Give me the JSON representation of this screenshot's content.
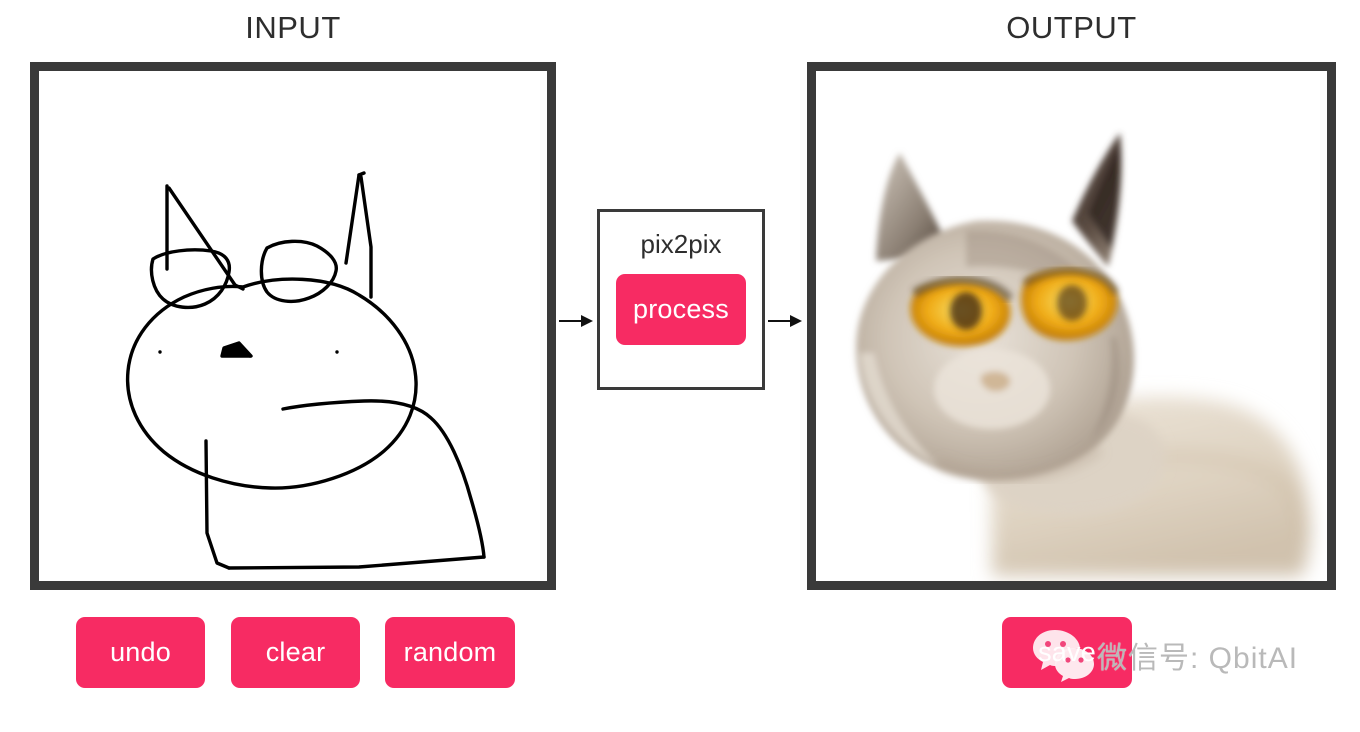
{
  "panels": {
    "input_title": "INPUT",
    "output_title": "OUTPUT"
  },
  "model": {
    "name": "pix2pix",
    "process_label": "process"
  },
  "controls": {
    "undo_label": "undo",
    "clear_label": "clear",
    "random_label": "random",
    "save_label": "save"
  },
  "watermark": {
    "text": "微信号: QbitAI",
    "logo": "wechat-icon"
  },
  "colors": {
    "accent_pink": "#F72B63",
    "frame_dark": "#3a3a3a",
    "page_background": "#ffffff",
    "title_text": "#2e2e2e",
    "watermark_text": "#b9b9b9"
  },
  "input_drawing": {
    "description": "hand-drawn cat sketch: oval head, two pointed ears, two eyes, nose, whisker dots, body",
    "stroke_color": "#000000"
  },
  "output_image": {
    "description": "pix2pix generated photorealistic cat with cream-grey fur, yellow-orange eyes and dark ear tips",
    "fur_light": "#ded5cb",
    "fur_mid": "#b8aa9c",
    "fur_dark": "#6d6258",
    "eye_color": "#f2b41c",
    "ear_tip": "#3b2f2a"
  }
}
